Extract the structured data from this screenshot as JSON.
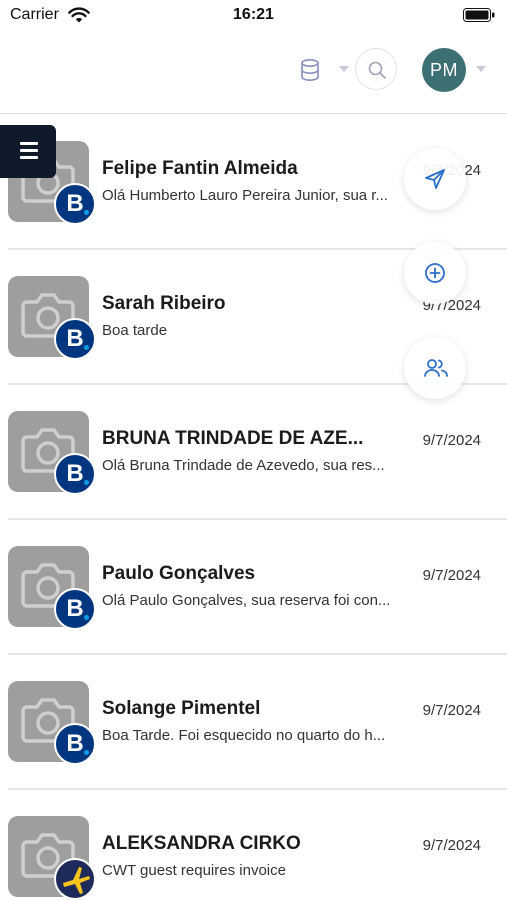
{
  "status_bar": {
    "carrier": "Carrier",
    "time": "16:21"
  },
  "header": {
    "avatar_initials": "PM",
    "avatar_color": "#3c7072"
  },
  "colors": {
    "booking_blue": "#003580",
    "menu_dark": "#0f1b2a",
    "action_blue": "#2a6fc9"
  },
  "conversations": [
    {
      "name": "Felipe Fantin Almeida",
      "preview": "Olá Humberto Lauro Pereira Junior, sua r...",
      "date": "9/7/2024",
      "channel": "booking"
    },
    {
      "name": "Sarah Ribeiro",
      "preview": "Boa tarde",
      "date": "9/7/2024",
      "channel": "booking"
    },
    {
      "name": "BRUNA TRINDADE DE AZE...",
      "preview": "Olá Bruna Trindade de Azevedo, sua res...",
      "date": "9/7/2024",
      "channel": "booking"
    },
    {
      "name": "Paulo Gonçalves",
      "preview": "Olá Paulo Gonçalves, sua reserva foi con...",
      "date": "9/7/2024",
      "channel": "booking"
    },
    {
      "name": "Solange Pimentel",
      "preview": "Boa Tarde. Foi esquecido no quarto do h...",
      "date": "9/7/2024",
      "channel": "booking"
    },
    {
      "name": "ALEKSANDRA CIRKO",
      "preview": "CWT guest requires invoice",
      "date": "9/7/2024",
      "channel": "expedia"
    }
  ],
  "badge_letter": "B",
  "icons": {
    "send": "send-icon",
    "add": "add-circle-icon",
    "users": "users-icon",
    "database": "database-icon",
    "search": "search-icon",
    "menu": "hamburger-menu-icon"
  }
}
